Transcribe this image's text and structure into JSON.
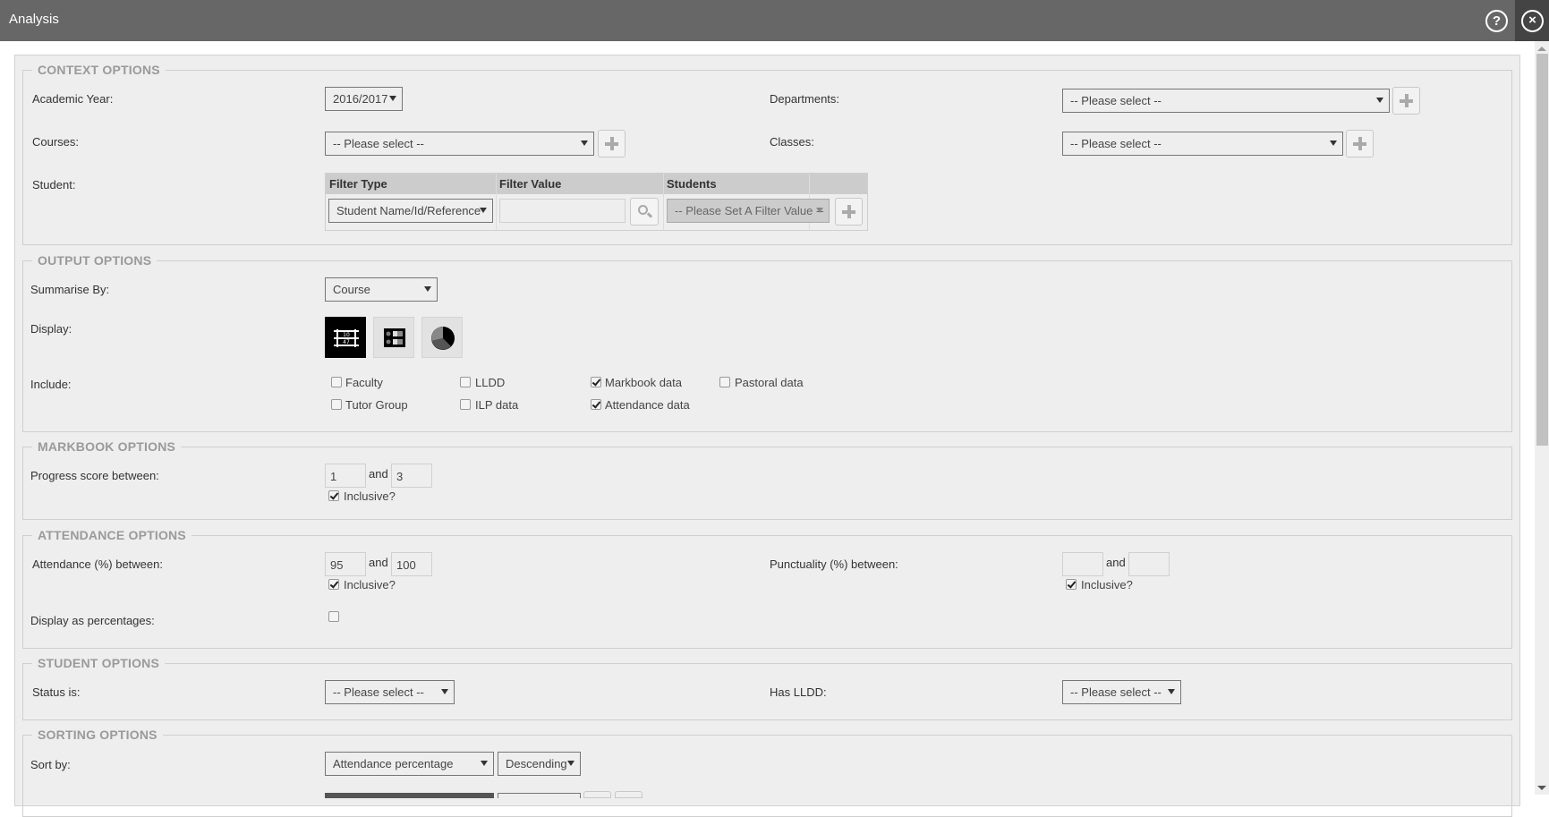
{
  "window": {
    "title": "Analysis",
    "help_icon": "?",
    "close_icon": "×"
  },
  "context": {
    "legend": "CONTEXT OPTIONS",
    "academic_year_label": "Academic Year:",
    "academic_year_value": "2016/2017",
    "departments_label": "Departments:",
    "departments_value": "-- Please select --",
    "courses_label": "Courses:",
    "courses_value": "-- Please select --",
    "classes_label": "Classes:",
    "classes_value": "-- Please select --",
    "student_label": "Student:",
    "student_table": {
      "headers": [
        "Filter Type",
        "Filter Value",
        "Students"
      ],
      "filter_type_value": "Student Name/Id/Reference",
      "filter_value": "",
      "students_value": "-- Please Set A Filter Value --"
    }
  },
  "output": {
    "legend": "OUTPUT OPTIONS",
    "summarise_label": "Summarise By:",
    "summarise_value": "Course",
    "display_label": "Display:",
    "display_options": [
      {
        "name": "table-view-icon",
        "active": true
      },
      {
        "name": "grid-view-icon",
        "active": false
      },
      {
        "name": "pie-chart-icon",
        "active": false
      }
    ],
    "include_label": "Include:",
    "include_options": [
      {
        "label": "Faculty",
        "checked": false
      },
      {
        "label": "LLDD",
        "checked": false
      },
      {
        "label": "Markbook data",
        "checked": true
      },
      {
        "label": "Pastoral data",
        "checked": false
      },
      {
        "label": "Tutor Group",
        "checked": false
      },
      {
        "label": "ILP data",
        "checked": false
      },
      {
        "label": "Attendance data",
        "checked": true
      }
    ]
  },
  "markbook": {
    "legend": "MARKBOOK OPTIONS",
    "progress_label": "Progress score between:",
    "progress_from": "1",
    "and_label": "and",
    "progress_to": "3",
    "inclusive_label": "Inclusive?",
    "inclusive_checked": true
  },
  "attendance": {
    "legend": "ATTENDANCE OPTIONS",
    "attendance_label": "Attendance (%) between:",
    "attendance_from": "95",
    "and_label": "and",
    "attendance_to": "100",
    "inclusive_label": "Inclusive?",
    "attendance_inclusive": true,
    "punctuality_label": "Punctuality (%) between:",
    "punctuality_from": "",
    "punctuality_to": "",
    "punctuality_inclusive": true,
    "display_pct_label": "Display as percentages:",
    "display_pct_checked": false
  },
  "student": {
    "legend": "STUDENT OPTIONS",
    "status_label": "Status is:",
    "status_value": "-- Please select --",
    "lldd_label": "Has LLDD:",
    "lldd_value": "-- Please select --"
  },
  "sorting": {
    "legend": "SORTING OPTIONS",
    "sort_label": "Sort by:",
    "sort_field": "Attendance percentage",
    "sort_order": "Descending"
  }
}
